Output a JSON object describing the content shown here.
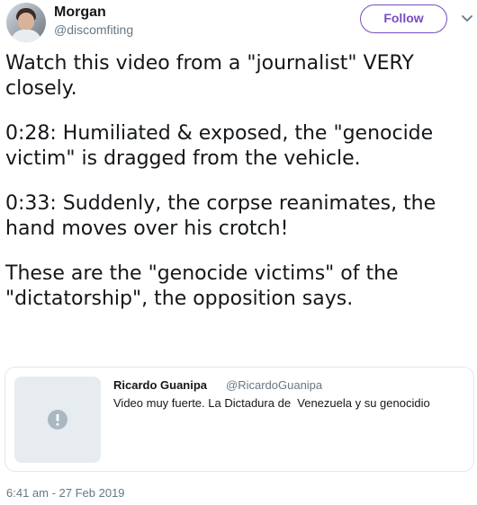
{
  "author": {
    "display_name": "Morgan",
    "handle": "@discomfiting"
  },
  "follow_label": "Follow",
  "tweet_paragraphs": [
    "Watch this video from a \"journalist\" VERY closely.",
    "0:28: Humiliated & exposed, the \"genocide victim\" is dragged from the vehicle.",
    "0:33: Suddenly, the corpse reanimates, the hand moves over his crotch!",
    "These are the \"genocide victims\" of the \"dictatorship\", the opposition says."
  ],
  "quoted_tweet": {
    "name": "Ricardo Guanipa",
    "handle": "@RicardoGuanipa",
    "text": "Video muy fuerte. La Dictadura de  Venezuela y su genocidio",
    "media_icon": "warning-circle-icon"
  },
  "timestamp": "6:41 am - 27 Feb 2019",
  "colors": {
    "accent": "#794bc4",
    "secondary_text": "#657786",
    "primary_text": "#14171a",
    "border": "#e1e8ed",
    "media_placeholder": "#e6ecf0",
    "icon_gray": "#aab8c2"
  }
}
